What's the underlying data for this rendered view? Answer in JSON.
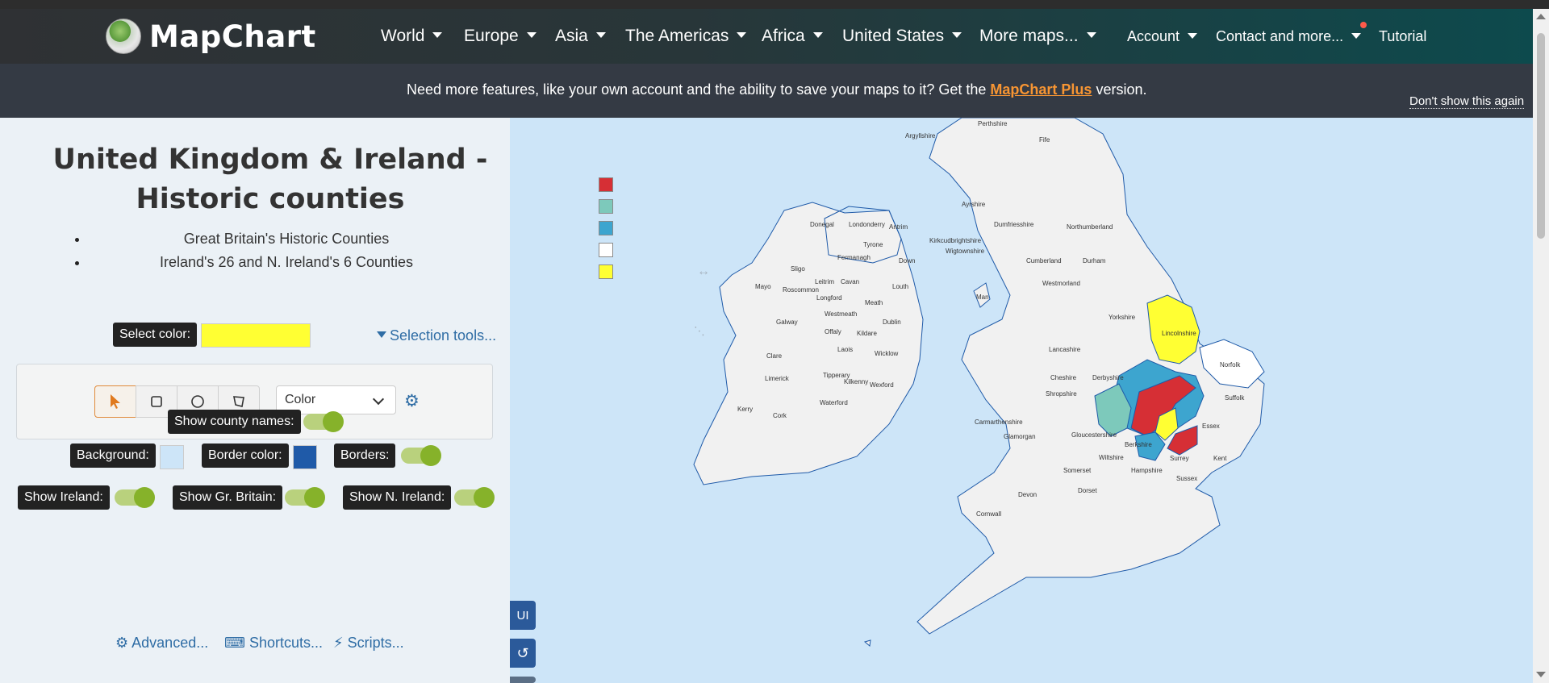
{
  "app": {
    "name": "MapChart"
  },
  "nav": {
    "items": [
      {
        "label": "World"
      },
      {
        "label": "Europe"
      },
      {
        "label": "Asia"
      },
      {
        "label": "The Americas"
      },
      {
        "label": "Africa"
      },
      {
        "label": "United States"
      },
      {
        "label": "More maps..."
      }
    ],
    "account": "Account",
    "contact": "Contact and more...",
    "tutorial": "Tutorial"
  },
  "banner": {
    "text_before": "Need more features, like your own account and the ability to save your maps to it? Get the",
    "link": "MapChart Plus",
    "text_after": "version.",
    "dismiss": "Don't show this again"
  },
  "panel": {
    "title": "United Kingdom & Ireland - Historic counties",
    "maps": [
      "Great Britain's Historic Counties",
      "Ireland's 26 and N. Ireland's 6 Counties"
    ],
    "select_color_label": "Select color:",
    "selected_color": "#ffff33",
    "selection_tools": "Selection tools...",
    "color_mode": "Color",
    "show_county_names": "Show county names:",
    "background_label": "Background:",
    "background_color": "#cde5f8",
    "border_color_label": "Border color:",
    "border_color": "#1f5aa8",
    "borders_label": "Borders:",
    "show_ireland": "Show Ireland:",
    "show_gb": "Show Gr. Britain:",
    "show_ni": "Show N. Ireland:",
    "advanced": "Advanced...",
    "shortcuts": "Shortcuts...",
    "scripts": "Scripts..."
  },
  "map": {
    "legend_colors": [
      "#d62f35",
      "#7dc9bb",
      "#3da5cf",
      "#ffffff",
      "#ffff33"
    ],
    "ui_button": "UI",
    "labels": [
      "Perthshire",
      "Argyllshire",
      "Fife",
      "Ayrshire",
      "Dumfriesshire",
      "Northumberland",
      "Kirkcudbrightshire",
      "Wigtownshire",
      "Cumberland",
      "Durham",
      "Westmorland",
      "Yorkshire",
      "Lancashire",
      "Lincolnshire",
      "Cheshire",
      "Derbyshire",
      "Norfolk",
      "Suffolk",
      "Essex",
      "Kent",
      "Surrey",
      "Sussex",
      "Hampshire",
      "Wiltshire",
      "Berkshire",
      "Somerset",
      "Dorset",
      "Devon",
      "Cornwall",
      "Glamorgan",
      "Carmarthenshire",
      "Shropshire",
      "Gloucestershire",
      "Man",
      "Donegal",
      "Londonderry",
      "Antrim",
      "Tyrone",
      "Down",
      "Sligo",
      "Leitrim",
      "Fermanagh",
      "Mayo",
      "Roscommon",
      "Cavan",
      "Louth",
      "Meath",
      "Longford",
      "Westmeath",
      "Galway",
      "Offaly",
      "Kildare",
      "Dublin",
      "Laois",
      "Wicklow",
      "Clare",
      "Tipperary",
      "Limerick",
      "Kilkenny",
      "Wexford",
      "Waterford",
      "Kerry",
      "Cork"
    ]
  }
}
